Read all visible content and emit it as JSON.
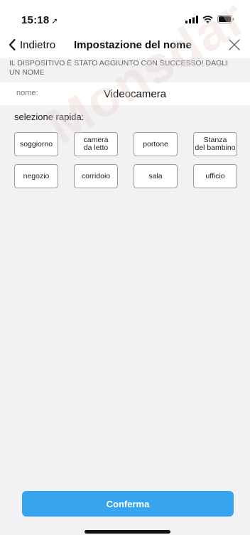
{
  "status_bar": {
    "time": "15:18",
    "location_icon": "location-arrow-icon",
    "icons": [
      "signal-icon",
      "wifi-icon",
      "battery-icon"
    ]
  },
  "nav": {
    "back_label": "Indietro",
    "title": "Impostazione del nome",
    "close_icon": "close-icon"
  },
  "notice": "IL DISPOSITIVO È STATO AGGIUNTO CON SUCCESSO! DAGLI UN NOME",
  "name_field": {
    "label": "nome:",
    "value": "Videocamera"
  },
  "quick_select": {
    "label": "selezione rapida:",
    "chips": [
      "soggiorno",
      "camera\nda letto",
      "portone",
      "Stanza\ndel bambino",
      "negozio",
      "corridoio",
      "sala",
      "ufficio"
    ]
  },
  "confirm_label": "Conferma",
  "watermark": "Monsdar",
  "colors": {
    "accent": "#36a4ee",
    "background": "#f2f2f4"
  }
}
